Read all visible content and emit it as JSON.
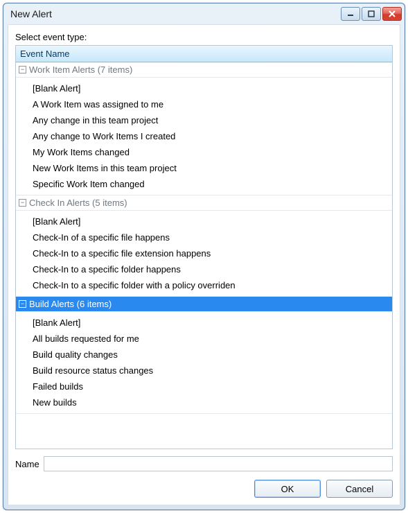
{
  "window": {
    "title": "New Alert"
  },
  "prompt": "Select event type:",
  "header": "Event Name",
  "groups": [
    {
      "label": "Work Item Alerts (7 items)",
      "selected": false,
      "items": [
        "[Blank Alert]",
        "A Work Item was assigned to me",
        "Any change in this team project",
        "Any change to Work Items I created",
        "My Work Items changed",
        "New Work Items in this team project",
        "Specific Work Item changed"
      ]
    },
    {
      "label": "Check In Alerts (5 items)",
      "selected": false,
      "items": [
        "[Blank Alert]",
        "Check-In of a specific file happens",
        "Check-In to a specific file extension happens",
        "Check-In to a specific folder happens",
        "Check-In to a specific folder with a policy overriden"
      ]
    },
    {
      "label": "Build Alerts (6 items)",
      "selected": true,
      "items": [
        "[Blank Alert]",
        "All builds requested for me",
        "Build quality changes",
        "Build resource status changes",
        "Failed builds",
        "New builds"
      ]
    }
  ],
  "nameLabel": "Name",
  "nameValue": "",
  "buttons": {
    "ok": "OK",
    "cancel": "Cancel"
  },
  "toggleGlyph": "−"
}
